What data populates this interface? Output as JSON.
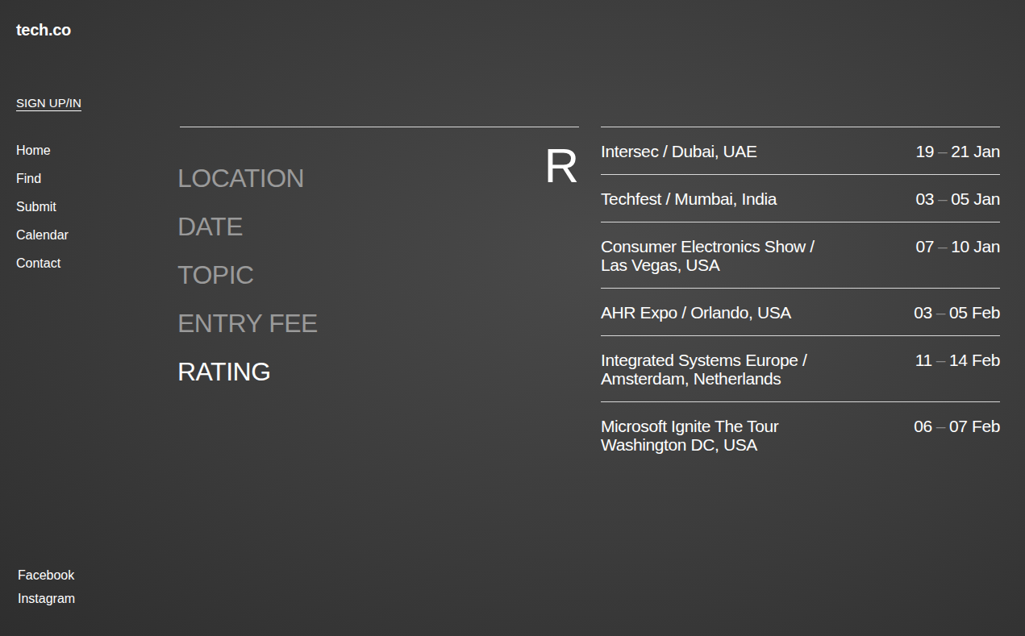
{
  "brand": {
    "logo": "tech.co",
    "auth_link": "SIGN UP/IN"
  },
  "nav": [
    {
      "label": "Home"
    },
    {
      "label": "Find"
    },
    {
      "label": "Submit"
    },
    {
      "label": "Calendar"
    },
    {
      "label": "Contact"
    }
  ],
  "social": [
    {
      "label": "Facebook"
    },
    {
      "label": "Instagram"
    }
  ],
  "filters": [
    {
      "label": "LOCATION",
      "selected": false
    },
    {
      "label": "DATE",
      "selected": false
    },
    {
      "label": "TOPIC",
      "selected": false
    },
    {
      "label": "ENTRY FEE",
      "selected": false
    },
    {
      "label": "RATING",
      "selected": true
    }
  ],
  "filter_initial": "R",
  "events": [
    {
      "lines": [
        "Intersec / Dubai, UAE"
      ],
      "from": "19",
      "sep": "–",
      "to": "21 Jan"
    },
    {
      "lines": [
        "Techfest / Mumbai, India"
      ],
      "from": "03",
      "sep": "–",
      "to": "05 Jan"
    },
    {
      "lines": [
        "Consumer Electronics Show /",
        "Las Vegas, USA"
      ],
      "from": "07",
      "sep": "–",
      "to": "10 Jan"
    },
    {
      "lines": [
        "AHR Expo / Orlando, USA"
      ],
      "from": "03",
      "sep": "–",
      "to": "05 Feb"
    },
    {
      "lines": [
        "Integrated Systems Europe /",
        "Amsterdam, Netherlands"
      ],
      "from": "11",
      "sep": "–",
      "to": "14 Feb"
    },
    {
      "lines": [
        "Microsoft Ignite The Tour",
        "Washington DC, USA"
      ],
      "from": "06",
      "sep": "–",
      "to": "07 Feb"
    }
  ]
}
